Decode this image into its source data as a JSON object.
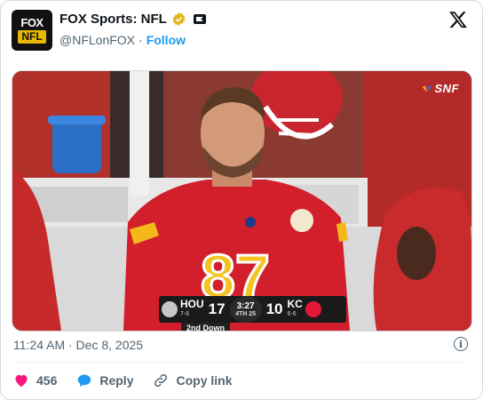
{
  "account": {
    "avatar_top": "FOX",
    "avatar_bottom": "NFL",
    "name": "FOX Sports: NFL",
    "handle": "@NFLonFOX",
    "separator": "·",
    "follow_label": "Follow"
  },
  "media": {
    "network_bug": "SNF",
    "scorebug": {
      "away_team": "HOU",
      "away_record": "7-6",
      "away_score": "17",
      "clock": "3:27",
      "quarter": "4TH",
      "play_clock": "25",
      "home_score": "10",
      "home_team": "KC",
      "home_record": "6-6",
      "down": "2nd Down"
    }
  },
  "meta": {
    "timestamp": "11:24 AM · Dec 8, 2025"
  },
  "actions": {
    "like_count": "456",
    "reply_label": "Reply",
    "copy_link_label": "Copy link"
  },
  "colors": {
    "link": "#1d9bf0",
    "like": "#f91880",
    "muted": "#536471",
    "chiefs_red": "#d21f2b",
    "chiefs_gold": "#f5b81a"
  }
}
